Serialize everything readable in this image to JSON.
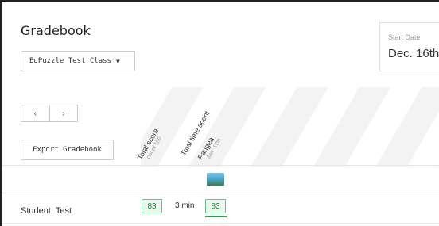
{
  "header": {
    "title": "Gradebook",
    "class_select": {
      "value": "EdPuzzle Test Class",
      "caret": "▼"
    },
    "start_date": {
      "label": "Start Date",
      "value": "Dec. 16th"
    }
  },
  "toolbar": {
    "prev": "‹",
    "next": "›",
    "export_label": "Export Gradebook"
  },
  "columns": [
    {
      "title": "Total score",
      "subtitle": "out of 100"
    },
    {
      "title": "Total time spent",
      "subtitle": ""
    },
    {
      "title": "Pangea",
      "subtitle": "Jan. 17th"
    }
  ],
  "rows": [
    {
      "student": "Student, Test",
      "total_score": "83",
      "time_spent": "3 min",
      "pangea_score": "83"
    }
  ],
  "colors": {
    "score_border": "#6cc08a",
    "score_bg": "#e9f7ee",
    "score_text": "#2d7d4a"
  }
}
